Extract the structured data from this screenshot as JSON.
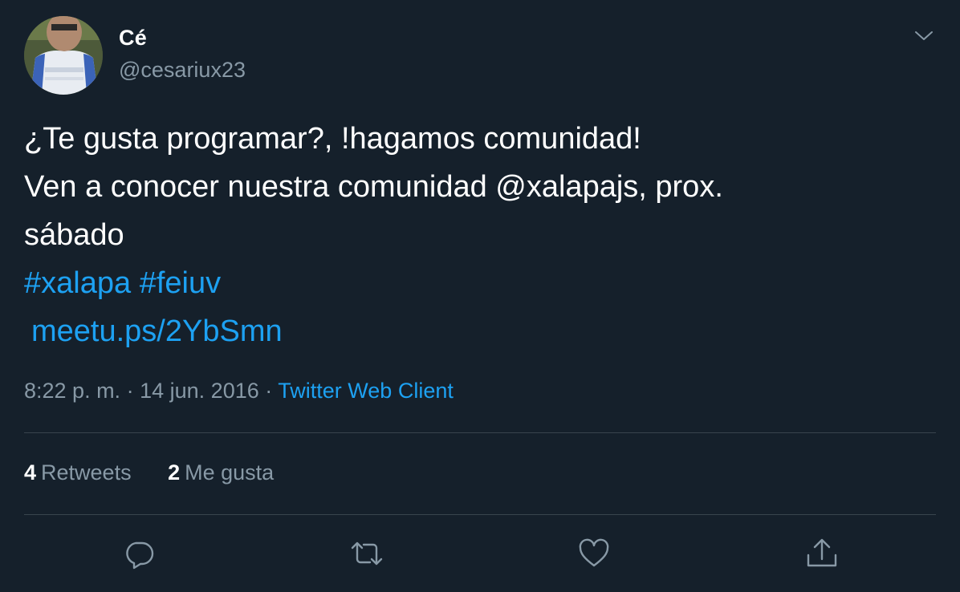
{
  "user": {
    "display_name": "Cé",
    "handle": "@cesariux23"
  },
  "tweet": {
    "line1": "¿Te gusta programar?, !hagamos comunidad!",
    "line2_prefix": "Ven a conocer nuestra comunidad ",
    "mention": "@xalapajs",
    "line2_suffix": ", prox.",
    "line3": "sábado",
    "hashtag1": "#xalapa",
    "hashtag2": "#feiuv",
    "url": "meetu.ps/2YbSmn"
  },
  "meta": {
    "time": "8:22 p. m.",
    "separator": "·",
    "date": "14 jun. 2016",
    "source": "Twitter Web Client"
  },
  "stats": {
    "retweets_count": "4",
    "retweets_label": "Retweets",
    "likes_count": "2",
    "likes_label": "Me gusta"
  },
  "colors": {
    "background": "#15202b",
    "text": "#ffffff",
    "secondary": "#8899a6",
    "accent": "#1da1f2",
    "divider": "#38444d"
  },
  "icons": [
    "chevron-down-icon",
    "reply-icon",
    "retweet-icon",
    "like-icon",
    "share-icon"
  ]
}
